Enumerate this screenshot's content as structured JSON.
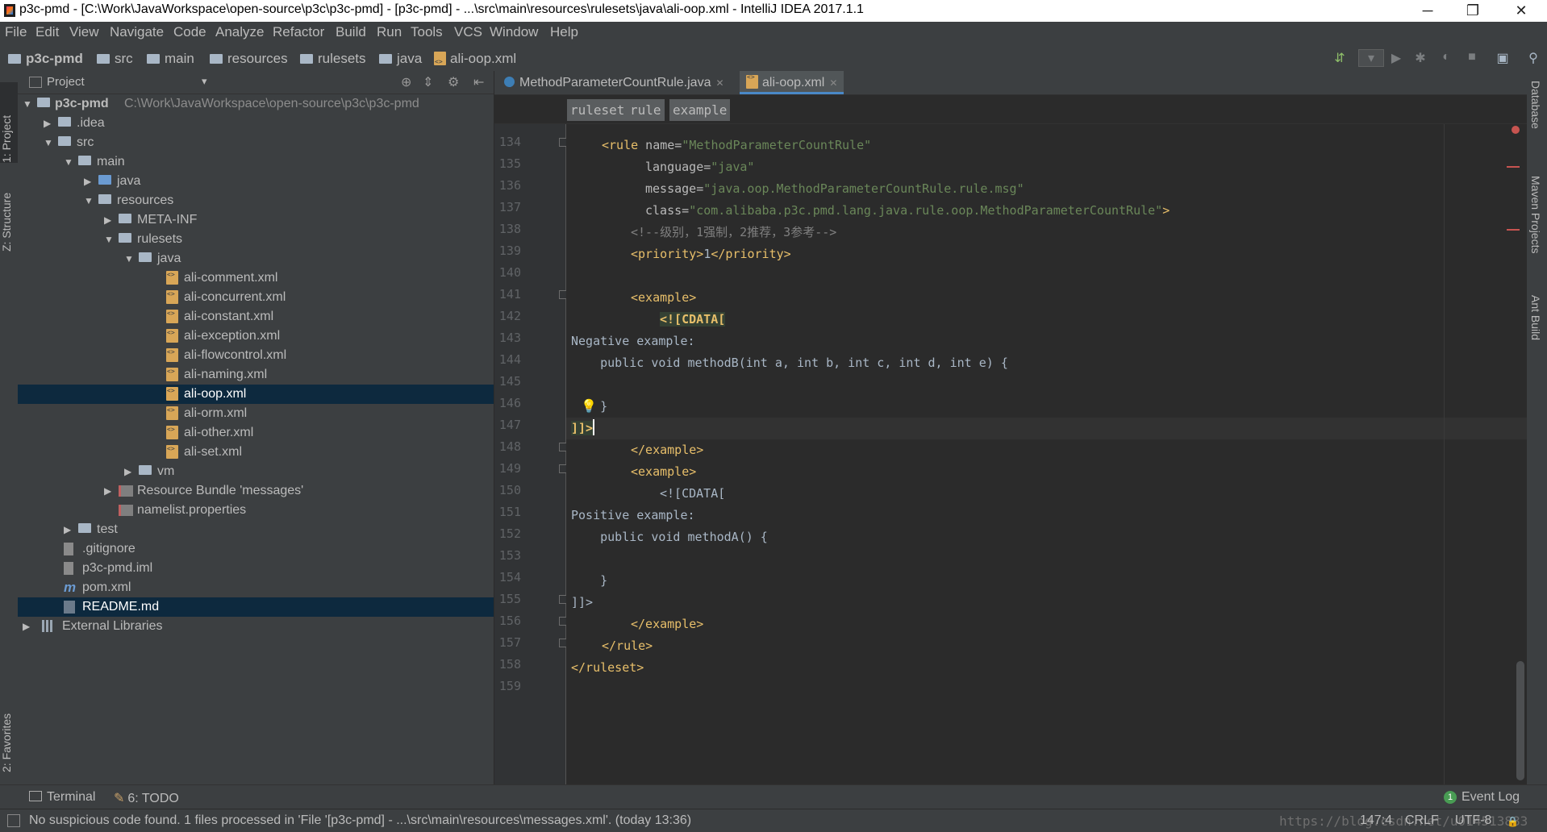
{
  "window": {
    "title": "p3c-pmd - [C:\\Work\\JavaWorkspace\\open-source\\p3c\\p3c-pmd] - [p3c-pmd] - ...\\src\\main\\resources\\rulesets\\java\\ali-oop.xml - IntelliJ IDEA 2017.1.1",
    "minimize": "─",
    "restore": "❐",
    "close": "✕"
  },
  "menu": [
    "File",
    "Edit",
    "View",
    "Navigate",
    "Code",
    "Analyze",
    "Refactor",
    "Build",
    "Run",
    "Tools",
    "VCS",
    "Window",
    "Help"
  ],
  "navbar": {
    "crumbs": [
      "p3c-pmd",
      "src",
      "main",
      "resources",
      "rulesets",
      "java",
      "ali-oop.xml"
    ]
  },
  "left_strip": {
    "project": "1: Project",
    "structure": "Z: Structure",
    "favorites": "2: Favorites"
  },
  "right_strip": {
    "database": "Database",
    "maven": "Maven Projects",
    "ant": "Ant Build"
  },
  "project_panel": {
    "title": "Project",
    "dropdown": "▾",
    "tree": [
      {
        "label": "p3c-pmd",
        "path": "C:\\Work\\JavaWorkspace\\open-source\\p3c\\p3c-pmd"
      },
      {
        "label": ".idea"
      },
      {
        "label": "src"
      },
      {
        "label": "main"
      },
      {
        "label": "java"
      },
      {
        "label": "resources"
      },
      {
        "label": "META-INF"
      },
      {
        "label": "rulesets"
      },
      {
        "label": "java"
      },
      {
        "label": "ali-comment.xml"
      },
      {
        "label": "ali-concurrent.xml"
      },
      {
        "label": "ali-constant.xml"
      },
      {
        "label": "ali-exception.xml"
      },
      {
        "label": "ali-flowcontrol.xml"
      },
      {
        "label": "ali-naming.xml"
      },
      {
        "label": "ali-oop.xml"
      },
      {
        "label": "ali-orm.xml"
      },
      {
        "label": "ali-other.xml"
      },
      {
        "label": "ali-set.xml"
      },
      {
        "label": "vm"
      },
      {
        "label": "Resource Bundle 'messages'"
      },
      {
        "label": "namelist.properties"
      },
      {
        "label": "test"
      },
      {
        "label": ".gitignore"
      },
      {
        "label": "p3c-pmd.iml"
      },
      {
        "label": "pom.xml"
      },
      {
        "label": "README.md"
      },
      {
        "label": "External Libraries"
      }
    ]
  },
  "editor": {
    "tabs": [
      {
        "label": "MethodParameterCountRule.java"
      },
      {
        "label": "ali-oop.xml"
      }
    ],
    "breadcrumbs": [
      "ruleset",
      "rule",
      "example"
    ],
    "line_numbers": [
      "134",
      "135",
      "136",
      "137",
      "138",
      "139",
      "140",
      "141",
      "142",
      "143",
      "144",
      "145",
      "146",
      "147",
      "148",
      "149",
      "150",
      "151",
      "152",
      "153",
      "154",
      "155",
      "156",
      "157",
      "158",
      "159"
    ],
    "code": {
      "l134_open": "<rule",
      "l134_attr": " name=",
      "l134_val": "\"MethodParameterCountRule\"",
      "l135_attr": "language=",
      "l135_val": "\"java\"",
      "l136_attr": "message=",
      "l136_val": "\"java.oop.MethodParameterCountRule.rule.msg\"",
      "l137_attr": "class=",
      "l137_val": "\"com.alibaba.p3c.pmd.lang.java.rule.oop.MethodParameterCountRule\"",
      "l137_close": ">",
      "l138_cmt": "<!--级别，1强制，2推荐，3参考-->",
      "l139_a": "<priority>",
      "l139_b": "1",
      "l139_c": "</priority>",
      "l141": "<example>",
      "l142": "<![CDATA[",
      "l143": "Negative example:",
      "l144": "    public void methodB(int a, int b, int c, int d, int e) {",
      "l146": "    }",
      "l147": "]]>",
      "l148": "</example>",
      "l149": "<example>",
      "l150": "<![CDATA[",
      "l151": "Positive example:",
      "l152": "    public void methodA() {",
      "l154": "    }",
      "l155": "]]>",
      "l156": "</example>",
      "l157": "</rule>",
      "l158": "</ruleset>"
    }
  },
  "tool_windows": {
    "terminal": "Terminal",
    "todo": "6: TODO",
    "event_log": "Event Log",
    "event_count": "1"
  },
  "status": {
    "message": "No suspicious code found. 1 files processed in 'File '[p3c-pmd] - ...\\src\\main\\resources\\messages.xml'. (today 13:36)",
    "position": "147:4",
    "line_sep": "CRLF",
    "encoding": "UTF-8",
    "watermark": "https://blog.csdn.net/u014513883"
  },
  "colors": {
    "accent": "#4a88c7",
    "selection": "#0d293e",
    "background": "#2b2b2b",
    "panel": "#3c3f41",
    "error": "#c75450"
  }
}
